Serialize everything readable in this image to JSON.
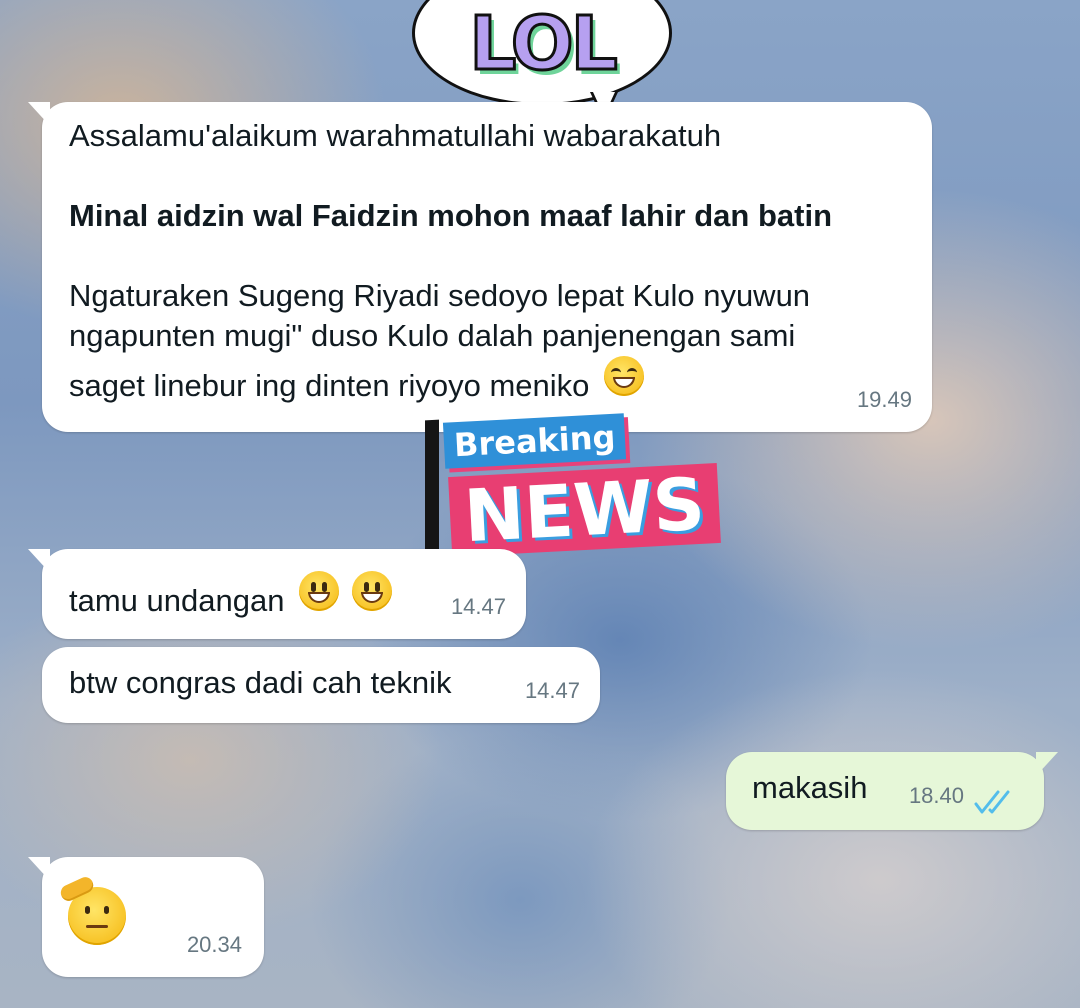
{
  "stickers": {
    "lol": "LOL",
    "breaking": "Breaking",
    "news": "NEWS"
  },
  "messages": [
    {
      "direction": "incoming",
      "lines": [
        "Assalamu'alaikum warahmatullahi wabarakatuh",
        "Minal aidzin wal Faidzin mohon maaf lahir dan batin",
        "Ngaturaken Sugeng Riyadi sedoyo lepat Kulo nyuwun",
        "ngapunten mugi\" duso Kulo dalah panjenengan sami",
        "saget linebur ing dinten riyoyo meniko"
      ],
      "emoji": "grinning-face-with-smiling-eyes",
      "time": "19.49"
    },
    {
      "direction": "incoming",
      "text": "tamu undangan",
      "emoji": "grinning-face x2",
      "time": "14.47"
    },
    {
      "direction": "incoming",
      "text": "btw congras dadi cah teknik",
      "time": "14.47"
    },
    {
      "direction": "outgoing",
      "text": "makasih",
      "time": "18.40",
      "status": "read",
      "status_color": "#53bdeb"
    },
    {
      "direction": "incoming",
      "emoji": "saluting-face",
      "time": "20.34"
    }
  ],
  "colors": {
    "incoming_bubble": "#ffffff",
    "outgoing_bubble": "#e6f7d8",
    "text": "#111b21",
    "time": "#667781"
  }
}
